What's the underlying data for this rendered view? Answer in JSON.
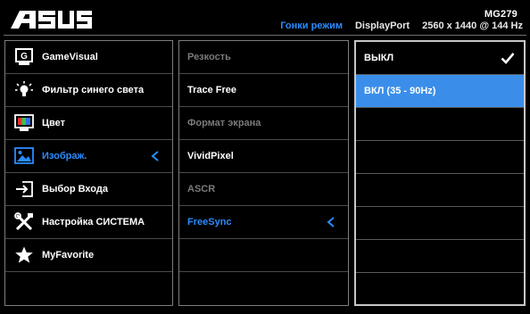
{
  "header": {
    "brand": "ASUS",
    "model": "MG279",
    "mode": "Гонки режим",
    "input": "DisplayPort",
    "resolution": "2560 x 1440 @",
    "refresh": "144 Hz"
  },
  "main_menu": [
    {
      "label": "GameVisual",
      "icon": "gamevisual-icon",
      "state": "normal"
    },
    {
      "label": "Фильтр синего света",
      "icon": "blue-light-icon",
      "state": "normal"
    },
    {
      "label": "Цвет",
      "icon": "color-icon",
      "state": "normal"
    },
    {
      "label": "Изображ.",
      "icon": "image-icon",
      "state": "active"
    },
    {
      "label": "Выбор Входа",
      "icon": "input-select-icon",
      "state": "normal"
    },
    {
      "label": "Настройка СИСТЕМА",
      "icon": "tools-icon",
      "state": "normal"
    },
    {
      "label": "MyFavorite",
      "icon": "star-icon",
      "state": "normal"
    },
    {
      "label": "",
      "icon": "",
      "state": "empty"
    }
  ],
  "sub_menu": [
    {
      "label": "Резкость",
      "state": "disabled"
    },
    {
      "label": "Trace Free",
      "state": "normal"
    },
    {
      "label": "Формат экрана",
      "state": "disabled"
    },
    {
      "label": "VividPixel",
      "state": "normal"
    },
    {
      "label": "ASCR",
      "state": "disabled"
    },
    {
      "label": "FreeSync",
      "state": "active"
    },
    {
      "label": "",
      "state": "empty"
    },
    {
      "label": "",
      "state": "empty"
    }
  ],
  "options": [
    {
      "label": "ВЫКЛ",
      "selected": true,
      "highlight": false
    },
    {
      "label": "ВКЛ (35 - 90Hz)",
      "selected": false,
      "highlight": true
    },
    {
      "label": "",
      "selected": false,
      "highlight": false
    },
    {
      "label": "",
      "selected": false,
      "highlight": false
    },
    {
      "label": "",
      "selected": false,
      "highlight": false
    },
    {
      "label": "",
      "selected": false,
      "highlight": false
    },
    {
      "label": "",
      "selected": false,
      "highlight": false
    },
    {
      "label": "",
      "selected": false,
      "highlight": false
    }
  ],
  "colors": {
    "accent": "#2a8cff",
    "highlight": "#3a8eea",
    "disabled": "#7a7a7a"
  }
}
